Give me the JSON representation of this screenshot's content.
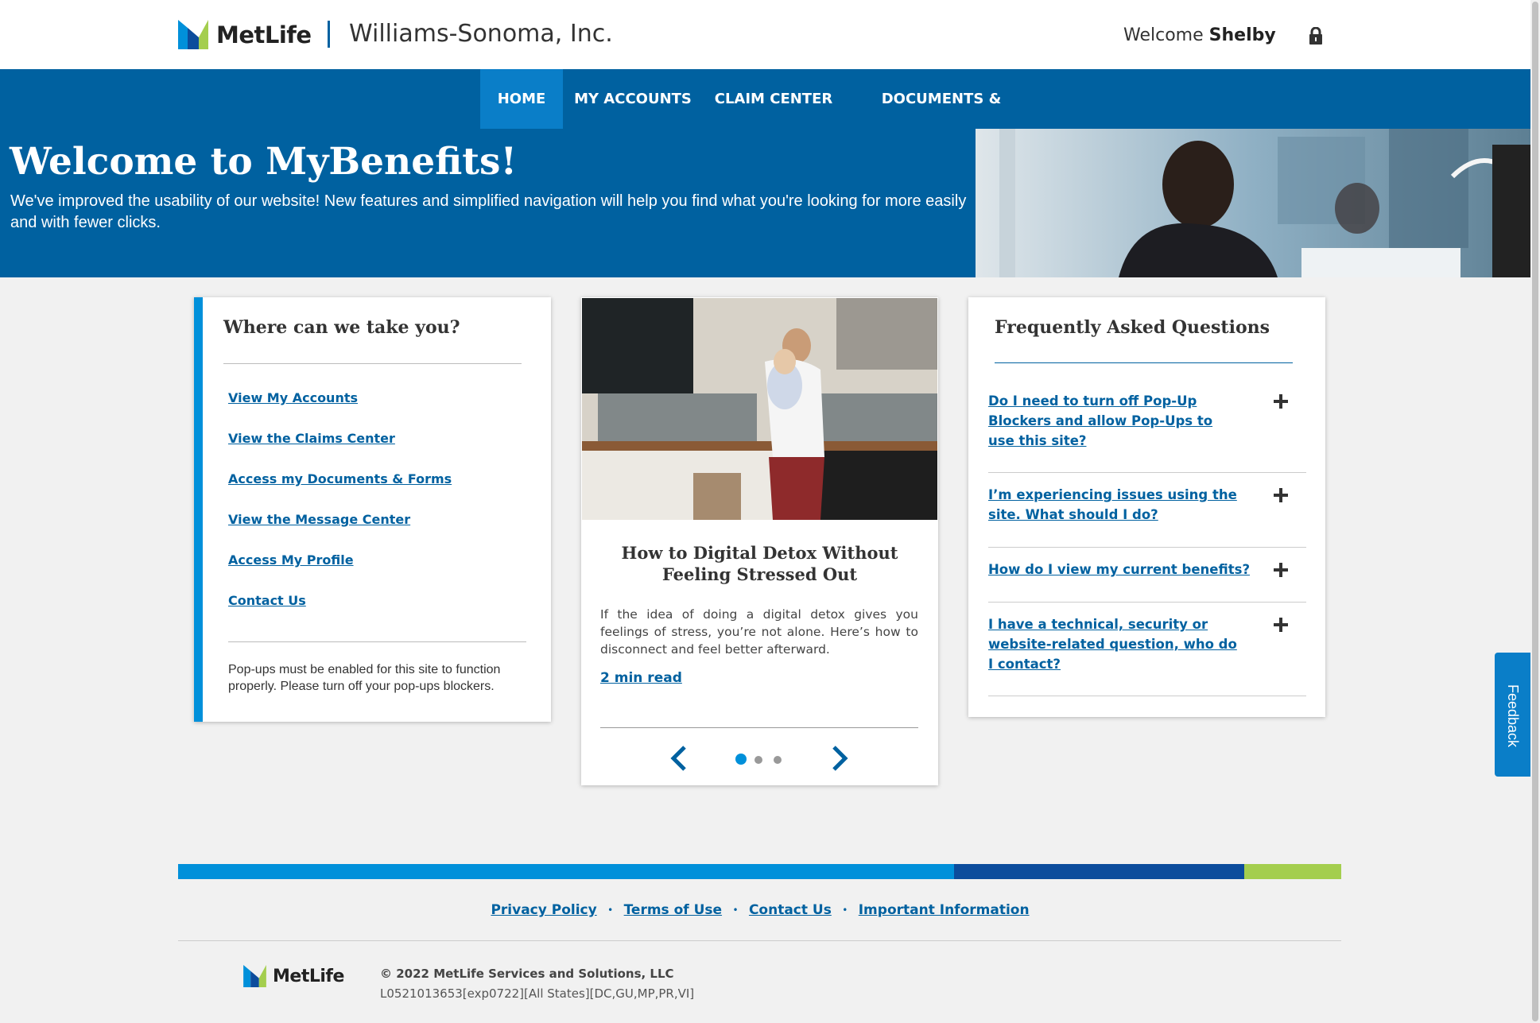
{
  "header": {
    "brand": "MetLife",
    "company": "Williams-Sonoma, Inc.",
    "welcome_prefix": "Welcome",
    "user_name": "Shelby",
    "lock_icon": "lock-icon"
  },
  "nav": {
    "items": [
      {
        "label": "HOME",
        "active": true
      },
      {
        "label": "MY ACCOUNTS",
        "active": false
      },
      {
        "label": "CLAIM CENTER",
        "active": false
      },
      {
        "label": "DOCUMENTS & FORMS",
        "active": false
      }
    ]
  },
  "hero": {
    "title": "Welcome to MyBenefits!",
    "text": "We've improved the usability of our website! New features and simplified navigation will help you find what you're looking for more easily and with fewer clicks."
  },
  "quicklinks": {
    "heading": "Where can we take you?",
    "links": [
      "View My Accounts",
      "View the Claims Center",
      "Access my Documents & Forms",
      "View the Message Center",
      "Access My Profile",
      "Contact Us"
    ],
    "note": "Pop-ups must be enabled for this site to function properly. Please turn off your pop-ups blockers."
  },
  "article": {
    "title": "How to Digital Detox Without Feeling Stressed Out",
    "description": "If the idea of doing a digital detox gives you feelings of stress, you’re not alone. Here’s how to disconnect and feel better afterward.",
    "read_label": "2 min read",
    "carousel_active": 1,
    "carousel_count": 3
  },
  "faq": {
    "heading": "Frequently Asked Questions",
    "items": [
      "Do I need to turn off Pop-Up Blockers and allow Pop-Ups to use this site?",
      "I’m experiencing issues using the site. What should I do?",
      "How do I view my current benefits?",
      "I have a technical, security or website-related question, who do I contact?"
    ]
  },
  "feedback_label": "Feedback",
  "footer": {
    "links": [
      "Privacy Policy",
      "Terms of Use",
      "Contact Us",
      "Important Information"
    ],
    "brand": "MetLife",
    "copyright": "© 2022 MetLife Services and Solutions, LLC",
    "code": "L0521013653[exp0722][All States][DC,GU,MP,PR,VI]"
  },
  "colors": {
    "primary_blue": "#0061a0",
    "light_blue": "#0090da",
    "dark_blue": "#0c4c9c",
    "green": "#a4ce4e",
    "background": "#f1f1f1"
  }
}
